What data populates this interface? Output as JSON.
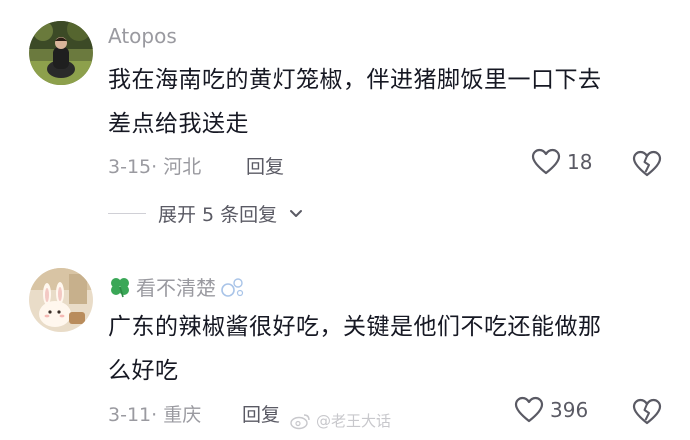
{
  "comments": [
    {
      "username": "Atopos",
      "text_line1": "我在海南吃的黄灯笼椒，伴进猪脚饭里一口下去",
      "text_line2": "差点给我送走",
      "meta": "3-15· 河北",
      "reply_label": "回复",
      "likes": "18",
      "expand_label": "展开 5 条回复",
      "avatar_icon": "person-sitting-photo"
    },
    {
      "username_prefix_icon": "four-leaf-clover-icon",
      "username": "看不清楚",
      "username_suffix_icon": "bubbles-icon",
      "text_line1": "广东的辣椒酱很好吃，关键是他们不吃还能做那",
      "text_line2": "么好吃",
      "meta": "3-11· 重庆",
      "reply_label": "回复",
      "likes": "396",
      "avatar_icon": "bunny-illustration"
    }
  ],
  "watermark": {
    "text": "@老王大话",
    "icon": "weibo-icon"
  },
  "colors": {
    "primary_text": "#161823",
    "secondary_text": "#9a9aa0",
    "action_text": "#5a5a64"
  }
}
